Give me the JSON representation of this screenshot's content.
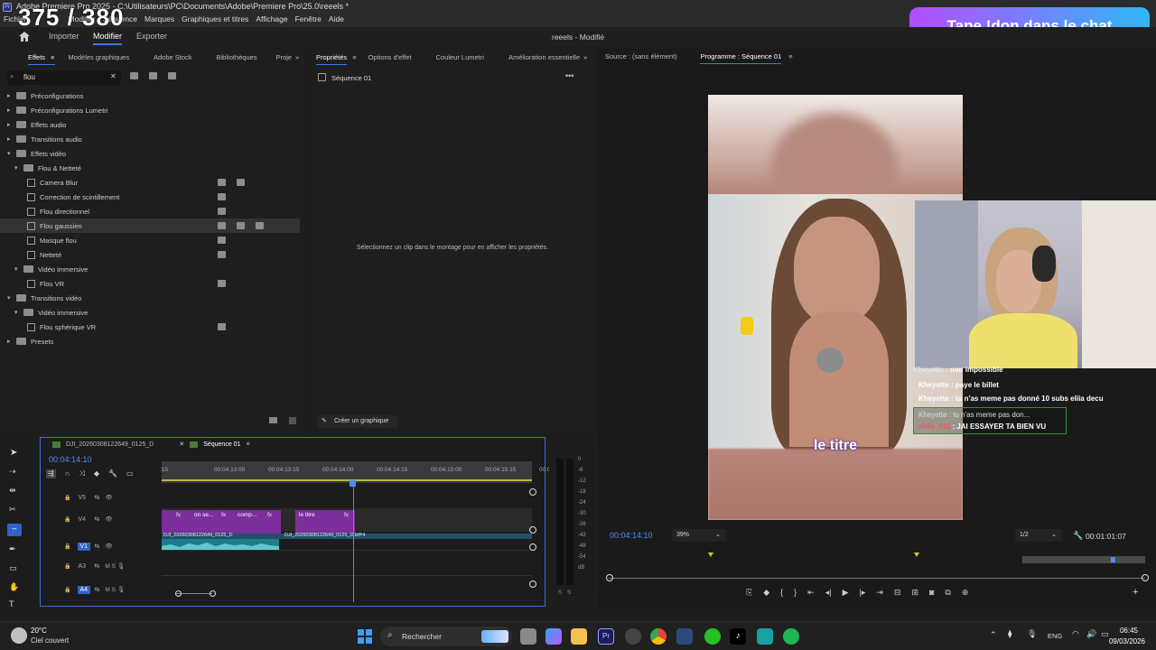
{
  "app": {
    "title": "Adobe Premiere Pro 2025 - C:\\Utilisateurs\\PC\\Documents\\Adobe\\Premiere Pro\\25.0\\reeels *",
    "counter_overlay": "375 / 380",
    "menu": [
      "Fichier",
      "Modifier",
      "Séquence",
      "Marques",
      "Graphiques et titres",
      "Affichage",
      "Fenêtre",
      "Aide"
    ]
  },
  "stream_banner": "Tape !don dans le chat",
  "workspace": {
    "tabs": [
      "Importer",
      "Modifier",
      "Exporter"
    ],
    "active": "Modifier",
    "project": "reeels - Modifié"
  },
  "effects_panel": {
    "tabs": [
      "Effets",
      "Modèles graphiques",
      "Adobe Stock",
      "Bibliothèques",
      "Proje"
    ],
    "search_value": "flou",
    "tree": [
      {
        "label": "Préconfigurations",
        "level": 0,
        "type": "folder",
        "open": false
      },
      {
        "label": "Préconfigurations Lumetri",
        "level": 0,
        "type": "folder",
        "open": false
      },
      {
        "label": "Effets audio",
        "level": 0,
        "type": "folder",
        "open": false
      },
      {
        "label": "Transitions audio",
        "level": 0,
        "type": "folder",
        "open": false
      },
      {
        "label": "Effets vidéo",
        "level": 0,
        "type": "folder",
        "open": true
      },
      {
        "label": "Flou & Netteté",
        "level": 1,
        "type": "folder",
        "open": true
      },
      {
        "label": "Camera Blur",
        "level": 2,
        "type": "effect",
        "badges": 2
      },
      {
        "label": "Correction de scintillement",
        "level": 2,
        "type": "effect",
        "badges": 1
      },
      {
        "label": "Flou directionnel",
        "level": 2,
        "type": "effect",
        "badges": 1
      },
      {
        "label": "Flou gaussien",
        "level": 2,
        "type": "effect",
        "badges": 3,
        "selected": true
      },
      {
        "label": "Masque flou",
        "level": 2,
        "type": "effect",
        "badges": 1
      },
      {
        "label": "Netteté",
        "level": 2,
        "type": "effect",
        "badges": 1
      },
      {
        "label": "Vidéo immersive",
        "level": 1,
        "type": "folder",
        "open": true
      },
      {
        "label": "Flou VR",
        "level": 2,
        "type": "effect",
        "badges": 1
      },
      {
        "label": "Transitions vidéo",
        "level": 0,
        "type": "folder",
        "open": true
      },
      {
        "label": "Vidéo immersive",
        "level": 1,
        "type": "folder",
        "open": true
      },
      {
        "label": "Flou sphérique VR",
        "level": 2,
        "type": "effect",
        "badges": 1
      },
      {
        "label": "Presets",
        "level": 0,
        "type": "folder",
        "open": false
      }
    ]
  },
  "properties_panel": {
    "tabs": [
      "Propriétés",
      "Options d'effet",
      "Couleur Lumetri",
      "Amélioration essentielle"
    ],
    "sequence": "Séquence 01",
    "empty_message": "Sélectionnez un clip dans le montage pour en afficher les propriétés.",
    "create_graphic": "Créer un graphique"
  },
  "program_panel": {
    "source_tab": "Source : (sans élément)",
    "program_tab": "Programme : Séquence 01",
    "caption": "le titre",
    "timecode": "00:04:14:10",
    "zoom": "39%",
    "resolution": "1/2",
    "duration": "00:01:01:07",
    "chat": [
      {
        "user": "Kheyette",
        "message": "non impossible"
      },
      {
        "user": "Kheyette",
        "message": "paye le billet"
      },
      {
        "user": "Kheyette",
        "message": "tu n'as meme pas donné 10 subs eliia decu"
      },
      {
        "user": "Kheyette",
        "message": "tu n'as meme pas don..."
      },
      {
        "user": "elilia_911",
        "message": "JAI ESSAYER TA BIEN VU"
      }
    ]
  },
  "timeline": {
    "tabs": [
      "DJI_20260308122649_0125_D",
      "Séquence 01"
    ],
    "timecode": "00:04:14:10",
    "ruler": [
      ":15",
      "00:04:13:00",
      "00:04:13:15",
      "00:04:14:00",
      "00:04:14:15",
      "00:04:15:00",
      "00:04:15:15",
      "00:0"
    ],
    "tracks": [
      "V5",
      "V4",
      "V1",
      "A3",
      "A4"
    ],
    "clips": [
      "on se...",
      "comp...",
      "le titre"
    ],
    "clip_file": "DJI_20260308122649_0125_D",
    "clip_file2": "DJI_20260308122649_0125_D.MP4",
    "meter_ticks": [
      "0",
      "-6",
      "-12",
      "-18",
      "-24",
      "-30",
      "-36",
      "-42",
      "-48",
      "-54",
      "dB"
    ]
  },
  "taskbar": {
    "weather_temp": "20°C",
    "weather_desc": "Ciel couvert",
    "search_placeholder": "Rechercher",
    "lang": "ENG",
    "time": "06:45",
    "date": "09/03/2026"
  },
  "colors": {
    "accent_blue": "#3b78e7",
    "clip_purple": "#7b2e9c",
    "audio_teal": "#1f7c8a",
    "banner_left": "#b34cff",
    "banner_right": "#2fb8f6"
  }
}
